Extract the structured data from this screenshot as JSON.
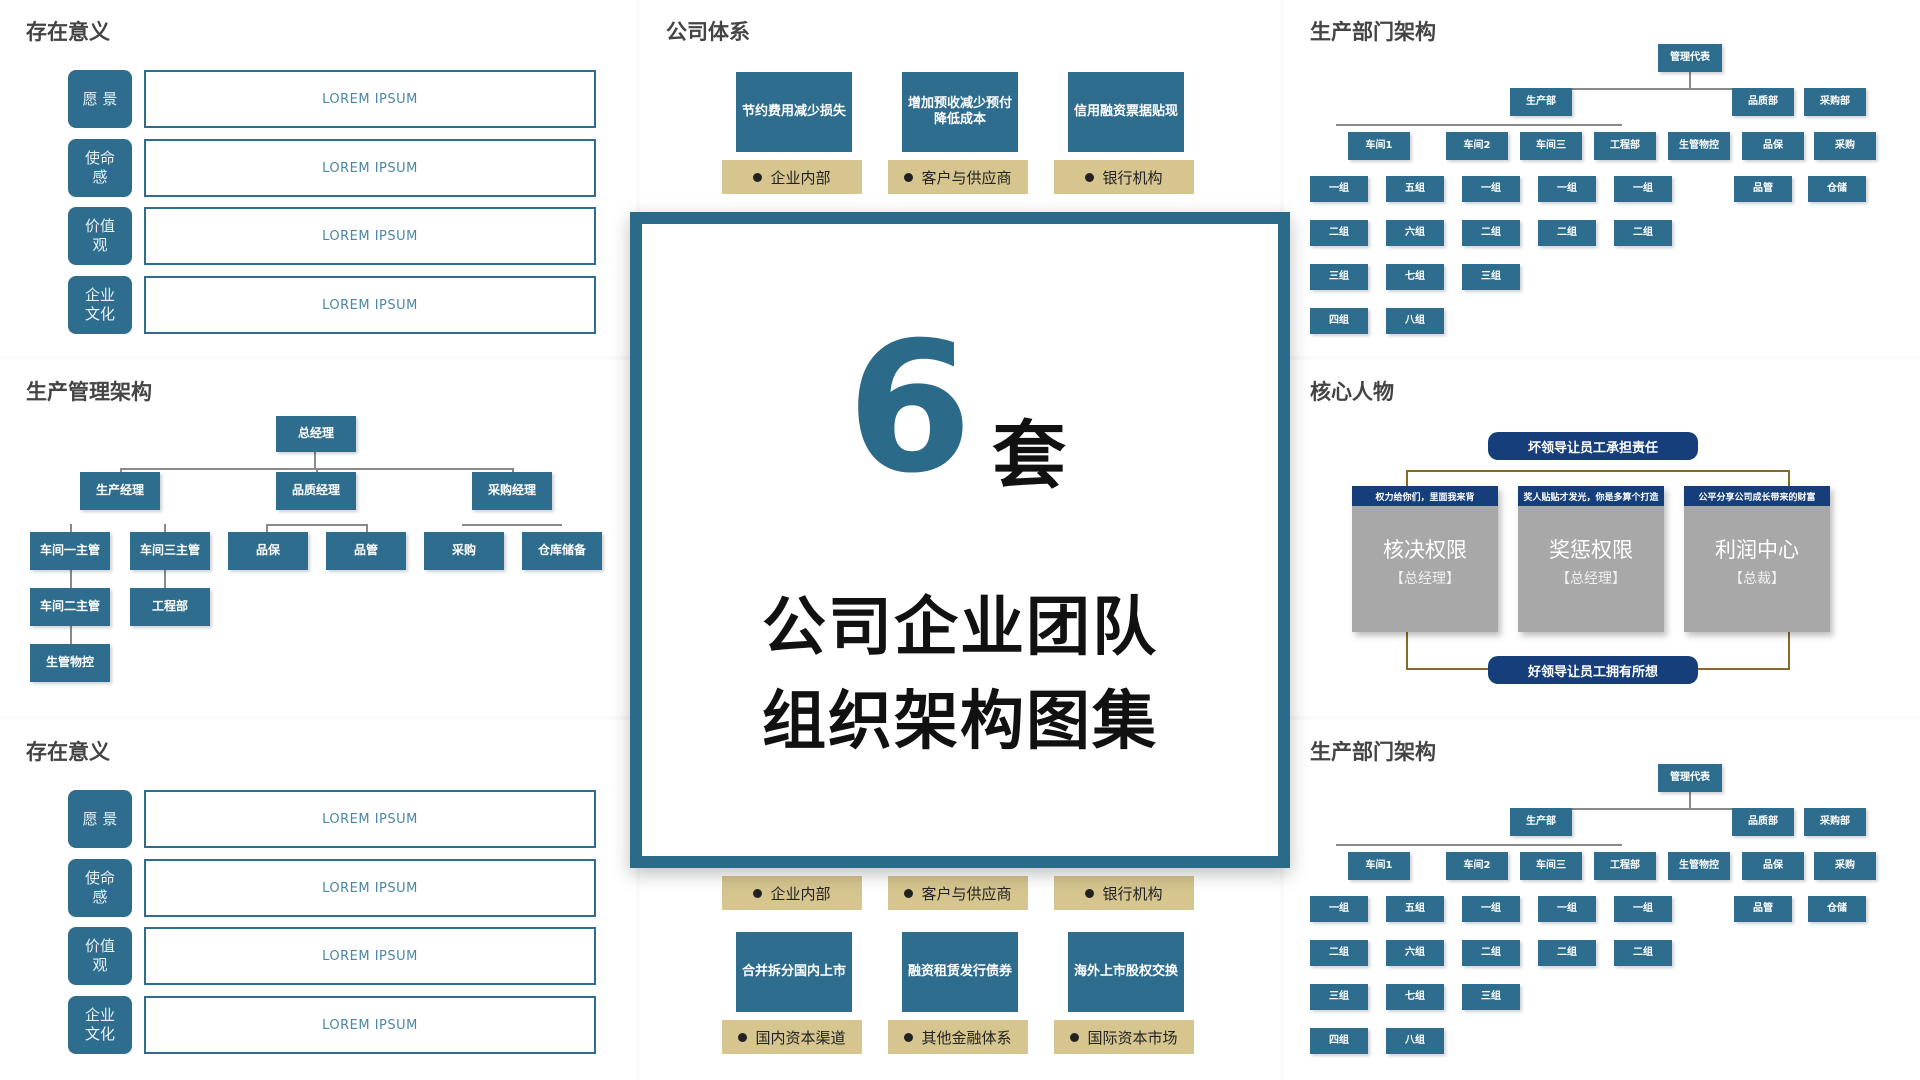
{
  "panels": {
    "p1_title": "存在意义",
    "p2_title": "公司体系",
    "p3_title": "生产部门架构",
    "p4_title": "生产管理架构",
    "p5_title": "核心人物",
    "p6_title": "存在意义",
    "p8_title": "生产部门架构"
  },
  "values": {
    "badges": [
      "愿 景",
      "使命感",
      "价值观",
      "企业文化"
    ],
    "box_text": "LOREM IPSUM"
  },
  "system": {
    "top_boxes": [
      "节约费用减少损失",
      "增加预收减少预付降低成本",
      "信用融资票据贴现"
    ],
    "top_labels": [
      "企业内部",
      "客户与供应商",
      "银行机构"
    ],
    "bottom_labels_upper": [
      "企业内部",
      "客户与供应商",
      "银行机构"
    ],
    "bottom_boxes": [
      "合并拆分国内上市",
      "融资租赁发行债券",
      "海外上市股权交换"
    ],
    "bottom_labels": [
      "国内资本渠道",
      "其他金融体系",
      "国际资本市场"
    ]
  },
  "dept": {
    "root": "管理代表",
    "level1": [
      "生产部",
      "品质部",
      "采购部"
    ],
    "level2": [
      "车间1",
      "车间2",
      "车间三",
      "工程部",
      "生管物控",
      "品保",
      "采购"
    ],
    "level3": [
      "一组",
      "五组",
      "一组",
      "一组",
      "一组",
      "二组",
      "六组",
      "二组",
      "二组",
      "二组",
      "三组",
      "七组",
      "三组",
      "四组",
      "八组",
      "品管",
      "仓储"
    ]
  },
  "mgmt": {
    "root": "总经理",
    "level1": [
      "生产经理",
      "品质经理",
      "采购经理"
    ],
    "level2": [
      "车间一主管",
      "车间三主管",
      "车间二主管",
      "工程部",
      "生管物控",
      "品保",
      "品管",
      "采购",
      "仓库储备"
    ]
  },
  "core": {
    "top_pill": "坏领导让员工承担责任",
    "bottom_pill": "好领导让员工拥有所想",
    "cards": [
      {
        "head": "权力给你们，里面我来背",
        "name": "核决权限",
        "sub": "【总经理】"
      },
      {
        "head": "奖人贴贴才发光，你是多算个打造",
        "name": "奖惩权限",
        "sub": "【总经理】"
      },
      {
        "head": "公平分享公司成长带来的财富",
        "name": "利润中心",
        "sub": "【总裁】"
      }
    ]
  },
  "center": {
    "number": "6",
    "unit": "套",
    "line1": "公司企业团队",
    "line2": "组织架构图集"
  }
}
